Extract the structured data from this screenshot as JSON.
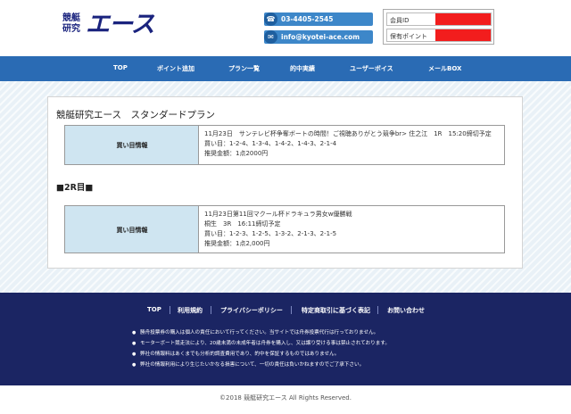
{
  "header": {
    "logo_small_line1": "競艇",
    "logo_small_line2": "研究",
    "logo_big": "エース",
    "phone": "03-4405-2545",
    "email": "info@kyotei-ace.com",
    "member_id_label": "会員ID",
    "points_label": "保有ポイント"
  },
  "nav": {
    "items": [
      "TOP",
      "ポイント追加",
      "プラン一覧",
      "的中実績",
      "ユーザーボイス",
      "メールBOX"
    ]
  },
  "plan": {
    "title": "競艇研究エース　スタンダードプラン",
    "boxes": [
      {
        "head": "買い目情報",
        "lines": [
          "11月23日　サンテレビ杯争奪ボートの時間！ご視聴ありがとう競争br> 住之江　1R　15:20締切予定",
          "買い目：1-2-4、1-3-4、1-4-2、1-4-3、2-1-4",
          "推奨金額：1点2000円"
        ]
      },
      {
        "head": "買い目情報",
        "lines": [
          "11月23日第11回マクール杯ドラキュラ男女w優勝戦",
          "桐生　3R　16:11締切予定",
          "買い目：1-2-3、1-2-5、1-3-2、2-1-3、2-1-5",
          "推奨金額：1点2,000円"
        ]
      }
    ],
    "section2_title": "■2R目■"
  },
  "footer": {
    "links": [
      "TOP",
      "利用規約",
      "プライバシーポリシー",
      "特定商取引に基づく表記",
      "お問い合わせ"
    ],
    "notes": [
      "勝舟投票券の購入は個人の責任において行ってください。当サイトでは舟券投票代行は行っておりません。",
      "モーターボート競走法により、20歳未満の未成年者は舟券を購入し、又は譲り受ける事は禁止されております。",
      "弊社の情報料はあくまでも分析的調査費用であり、的中を保証するものではありません。",
      "弊社の情報利用により生じたいかなる損害について、一切の責任は負いかねますのでご了承下さい。"
    ],
    "copyright": "©2018 競艇研究エース All Rights Reserved."
  },
  "colors": {
    "brand_navy": "#1a237e",
    "nav_blue": "#2a6bb4",
    "footer_navy": "#1b2563",
    "redacted": "#f21d1d",
    "info_head_bg": "#cfe5f1"
  },
  "icons": {
    "phone": "phone-icon",
    "mail": "mail-icon"
  }
}
